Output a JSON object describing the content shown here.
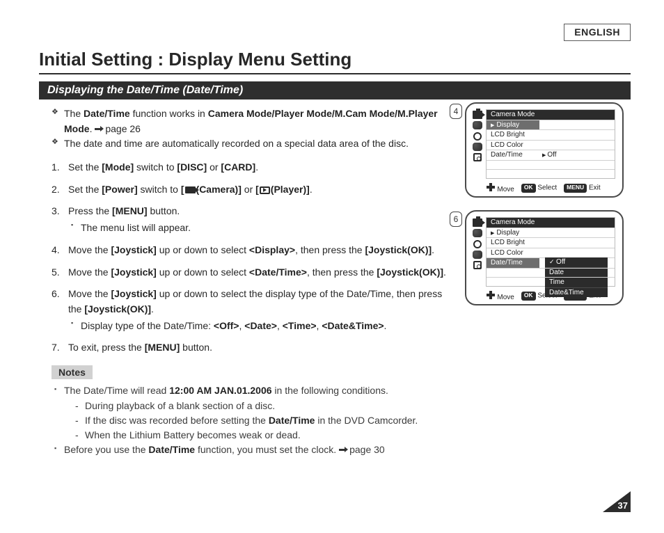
{
  "language_label": "ENGLISH",
  "page_title": "Initial Setting : Display Menu Setting",
  "section_title": "Displaying the Date/Time (Date/Time)",
  "intro": {
    "line1_prefix": "The ",
    "line1_term1": "Date/Time",
    "line1_mid": " function works in ",
    "line1_term2": "Camera Mode/Player Mode/M.Cam Mode/M.Player Mode",
    "line1_pageref": "page 26",
    "line2": "The date and time are automatically recorded on a special data area of the disc."
  },
  "steps": {
    "s1": {
      "pre": "Set the ",
      "b1": "[Mode]",
      "mid1": " switch to ",
      "b2": "[DISC]",
      "mid2": " or ",
      "b3": "[CARD]",
      "end": "."
    },
    "s2": {
      "pre": "Set the ",
      "b1": "[Power]",
      "mid1": " switch to ",
      "b2a": "[",
      "b2b": "(Camera)]",
      "mid2": " or ",
      "b3a": "[",
      "b3b": "(Player)]",
      "end": "."
    },
    "s3": {
      "pre": "Press the ",
      "b1": "[MENU]",
      "mid1": " button.",
      "sub1": "The menu list will appear."
    },
    "s4": {
      "pre": "Move the ",
      "b1": "[Joystick]",
      "mid1": " up or down to select ",
      "b2": "<Display>",
      "mid2": ", then press the ",
      "b3": "[Joystick(OK)]",
      "end": "."
    },
    "s5": {
      "pre": "Move the ",
      "b1": "[Joystick]",
      "mid1": " up or down to select ",
      "b2": "<Date/Time>",
      "mid2": ", then press the ",
      "b3": "[Joystick(OK)]",
      "end": "."
    },
    "s6": {
      "pre": "Move the ",
      "b1": "[Joystick]",
      "mid1": " up or down to select the display type of the Date/Time, then press the ",
      "b2": "[Joystick(OK)]",
      "end": ".",
      "sub_pre": "Display type of the Date/Time: ",
      "o1": "<Off>",
      "o2": "<Date>",
      "o3": "<Time>",
      "o4": "<Date&Time>",
      "sub_end": "."
    },
    "s7": {
      "pre": "To exit, press the ",
      "b1": "[MENU]",
      "end": " button."
    }
  },
  "notes_label": "Notes",
  "notes": {
    "n1_pre": "The Date/Time will read ",
    "n1_bold": "12:00 AM JAN.01.2006",
    "n1_post": " in the following conditions.",
    "n1_d1": "During playback of a blank section of a disc.",
    "n1_d2_pre": "If the disc was recorded before setting the ",
    "n1_d2_bold": "Date/Time",
    "n1_d2_post": " in the DVD Camcorder.",
    "n1_d3": "When the Lithium Battery becomes weak or dead.",
    "n2_pre": "Before you use the ",
    "n2_bold": "Date/Time",
    "n2_mid": " function, you must set the clock. ",
    "n2_pageref": "page 30"
  },
  "callouts": {
    "c4": {
      "num": "4",
      "header": "Camera Mode",
      "sel_row": "Display",
      "rows": {
        "r1": "LCD Bright",
        "r2": "LCD Color",
        "r3": "Date/Time"
      },
      "value": "Off",
      "legend": {
        "move": "Move",
        "ok": "OK",
        "select": "Select",
        "menu": "MENU",
        "exit": "Exit"
      }
    },
    "c6": {
      "num": "6",
      "header": "Camera Mode",
      "sel_row": "Display",
      "rows": {
        "r1": "LCD Bright",
        "r2": "LCD Color",
        "r3": "Date/Time"
      },
      "options": {
        "o1": "Off",
        "o2": "Date",
        "o3": "Time",
        "o4": "Date&Time"
      },
      "legend": {
        "move": "Move",
        "ok": "OK",
        "select": "Select",
        "menu": "MENU",
        "exit": "Exit"
      }
    }
  },
  "page_number": "37"
}
